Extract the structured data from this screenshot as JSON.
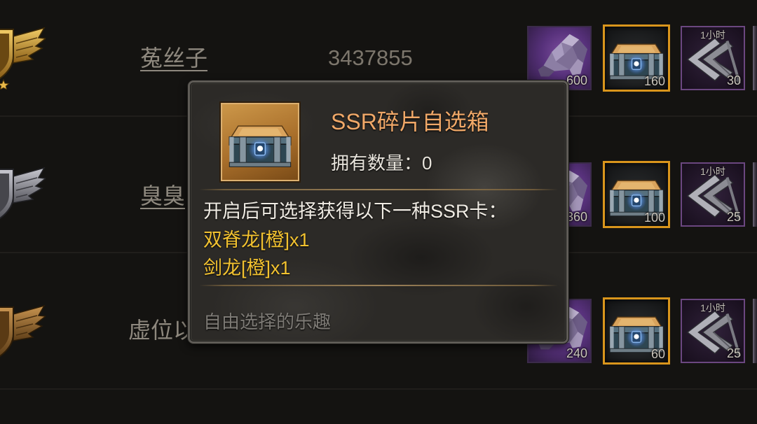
{
  "leaderboard": {
    "rows": [
      {
        "badge": "gold-wing-badge-icon",
        "name": "菟丝子",
        "score": "3437855",
        "rewards": [
          {
            "icon": "crystal-icon",
            "count": "600"
          },
          {
            "icon": "chest-icon",
            "count": "160"
          },
          {
            "icon": "arrow-icon",
            "label": "1小时",
            "count": "30"
          }
        ]
      },
      {
        "badge": "silver-wing-badge-icon",
        "name": "臭臭",
        "rewards": [
          {
            "icon": "crystal-icon",
            "count": "360"
          },
          {
            "icon": "chest-icon",
            "count": "100"
          },
          {
            "icon": "arrow-icon",
            "label": "1小时",
            "count": "25"
          }
        ]
      },
      {
        "badge": "bronze-wing-badge-icon",
        "name": "虚位以",
        "rewards": [
          {
            "icon": "crystal-icon",
            "count": "240"
          },
          {
            "icon": "chest-icon",
            "count": "60"
          },
          {
            "icon": "arrow-icon",
            "label": "1小时",
            "count": "25"
          }
        ]
      }
    ]
  },
  "item_tooltip": {
    "icon": "chest-icon",
    "title": "SSR碎片自选箱",
    "owned_label": "拥有数量：",
    "owned_value": "0",
    "description": "开启后可选择获得以下一种SSR卡：",
    "options": [
      "双脊龙[橙]x1",
      "剑龙[橙]x1"
    ],
    "flavor_text": "自由选择的乐趣"
  },
  "colors": {
    "background": "#141311",
    "tooltip_title": "#f0a868",
    "tooltip_option": "#f2c230",
    "tooltip_flavor": "#7d7a75",
    "chest_border": "#d9951c",
    "arrow_border": "#6b4780"
  }
}
